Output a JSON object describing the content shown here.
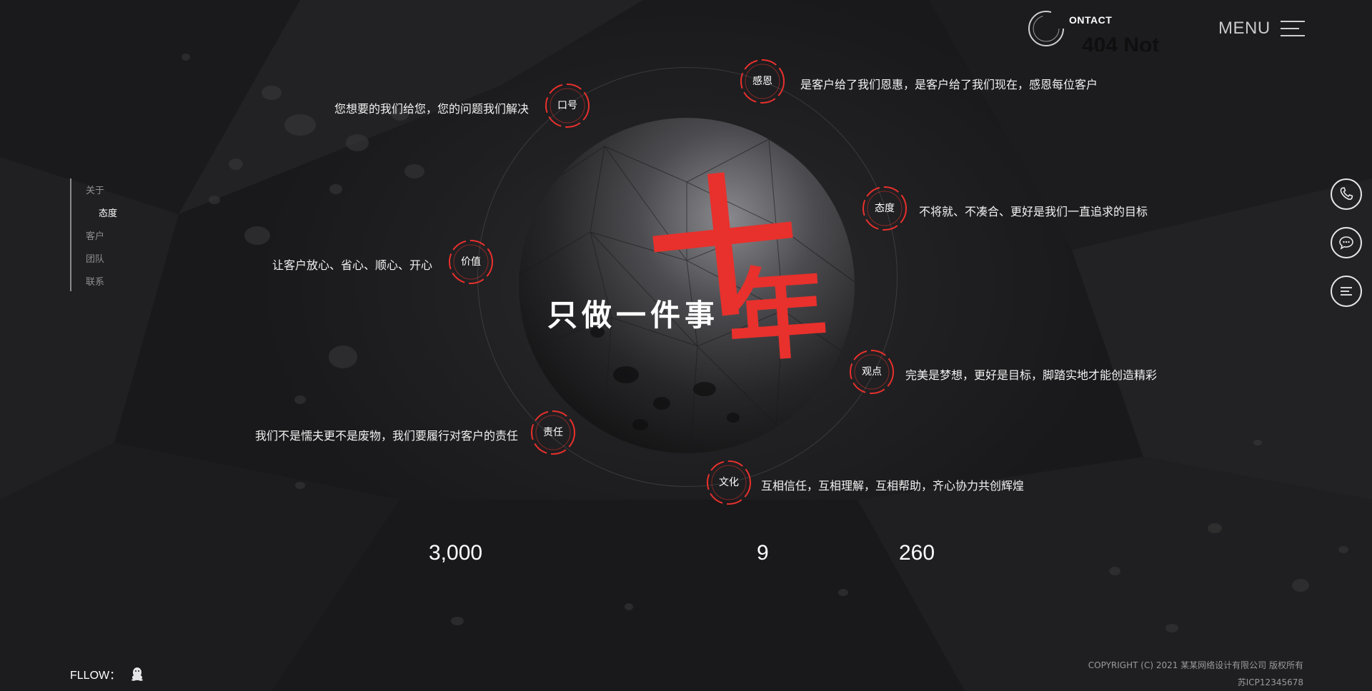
{
  "header": {
    "contact_label": "ONTACT",
    "contact_overlay": "404 Not",
    "menu_label": "MENU"
  },
  "sidenav": {
    "items": [
      {
        "label": "关于",
        "active": false
      },
      {
        "label": "态度",
        "active": true
      },
      {
        "label": "客户",
        "active": false
      },
      {
        "label": "团队",
        "active": false
      },
      {
        "label": "联系",
        "active": false
      }
    ]
  },
  "hero": {
    "slogan": "只做一件事",
    "headline": "十年"
  },
  "topics": [
    {
      "label": "口号",
      "text": "您想要的我们给您，您的问题我们解决"
    },
    {
      "label": "感恩",
      "text": "是客户给了我们恩惠，是客户给了我们现在，感恩每位客户"
    },
    {
      "label": "态度",
      "text": "不将就、不凑合、更好是我们一直追求的目标"
    },
    {
      "label": "价值",
      "text": "让客户放心、省心、顺心、开心"
    },
    {
      "label": "观点",
      "text": "完美是梦想，更好是目标，脚踏实地才能创造精彩"
    },
    {
      "label": "责任",
      "text": "我们不是懦夫更不是废物，我们要履行对客户的责任"
    },
    {
      "label": "文化",
      "text": "互相信任，互相理解，互相帮助，齐心协力共创辉煌"
    }
  ],
  "stats": [
    "3,000",
    "9",
    "260"
  ],
  "side_buttons": [
    {
      "icon": "phone-icon"
    },
    {
      "icon": "chat-icon"
    },
    {
      "icon": "menu-lines-icon"
    }
  ],
  "footer": {
    "follow_label": "FLLOW：",
    "follow_icon": "qq-penguin-icon",
    "copyright": "COPYRIGHT (C) 2021 某某网络设计有限公司 版权所有",
    "icp": "苏ICP12345678"
  },
  "colors": {
    "accent": "#e8302c",
    "background": "#1d1d1f",
    "nav_muted": "#8e8e92"
  }
}
